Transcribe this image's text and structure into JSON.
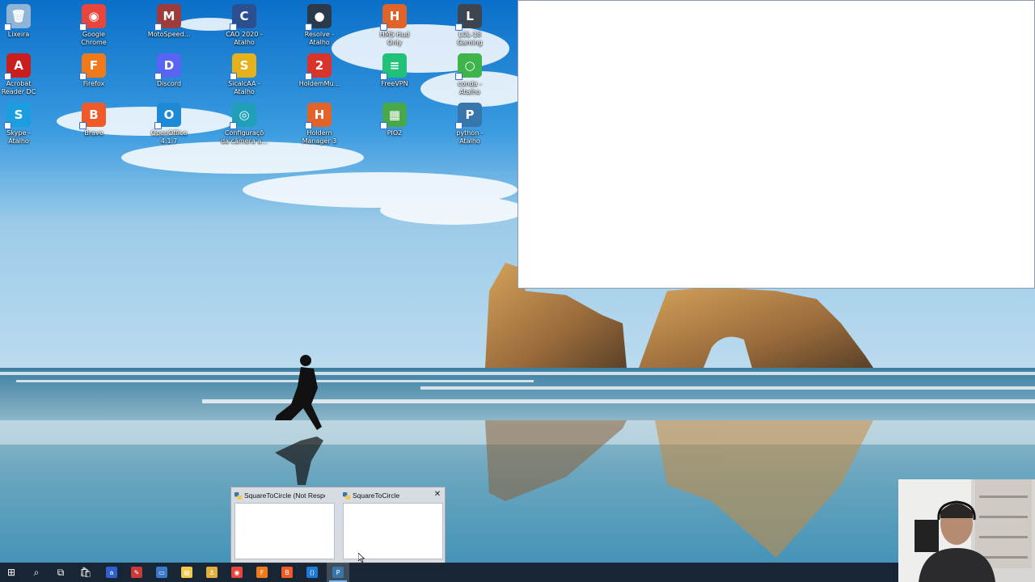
{
  "desktop": {
    "icons": [
      {
        "label": "Lixeira",
        "glyph": "🗑",
        "color": "#8fb4d8"
      },
      {
        "label": "Google\nChrome",
        "glyph": "◉",
        "color": "#e8453c"
      },
      {
        "label": "MotoSpeed...",
        "glyph": "M",
        "color": "#9e3b3b"
      },
      {
        "label": "CAO 2020 -\nAtalho",
        "glyph": "C",
        "color": "#2c4f8f"
      },
      {
        "label": "Resolve -\nAtalho",
        "glyph": "●",
        "color": "#2b3a4a"
      },
      {
        "label": "HMS Hud\nOnly",
        "glyph": "H",
        "color": "#e0632a"
      },
      {
        "label": "LOL-18\nGaming",
        "glyph": "L",
        "color": "#3d4550"
      },
      {
        "label": "Acrobat\nReader DC",
        "glyph": "A",
        "color": "#c81e1e"
      },
      {
        "label": "Firefox",
        "glyph": "F",
        "color": "#f07a1a"
      },
      {
        "label": "Discord",
        "glyph": "D",
        "color": "#5865f2"
      },
      {
        "label": "SicalcAA -\nAtalho",
        "glyph": "S",
        "color": "#e5b21c"
      },
      {
        "label": "HoldemMu...",
        "glyph": "2",
        "color": "#d9342b"
      },
      {
        "label": "FreeVPN",
        "glyph": "≡",
        "color": "#22c17a"
      },
      {
        "label": "conda -\nAtalho",
        "glyph": "○",
        "color": "#3db54a"
      },
      {
        "label": "Skype -\nAtalho",
        "glyph": "S",
        "color": "#1b9ee0"
      },
      {
        "label": "Brave",
        "glyph": "B",
        "color": "#f05a28"
      },
      {
        "label": "OpenOffice\n4.1.7",
        "glyph": "O",
        "color": "#1e8ad6"
      },
      {
        "label": "Configuraçõ\nda câmera a...",
        "glyph": "◎",
        "color": "#1fa0b8"
      },
      {
        "label": "Holdem\nManager 3",
        "glyph": "H",
        "color": "#e0632a"
      },
      {
        "label": "PIO2",
        "glyph": "▦",
        "color": "#49a84a"
      },
      {
        "label": "python -\nAtalho",
        "glyph": "P",
        "color": "#3776ab"
      }
    ]
  },
  "thumbnail_popup": {
    "items": [
      {
        "title": "SquareToCircle (Not Respondi..."
      },
      {
        "title": "SquareToCircle",
        "close_glyph": "✕"
      }
    ]
  },
  "taskbar": {
    "items": [
      {
        "name": "start-icon",
        "glyph": "⊞",
        "color": "#ffffff"
      },
      {
        "name": "search-icon",
        "glyph": "⌕",
        "color": "#ffffff"
      },
      {
        "name": "task-view-icon",
        "glyph": "⧉",
        "color": "#ffffff"
      },
      {
        "name": "store-icon",
        "glyph": "🛍",
        "color": "#ffffff"
      },
      {
        "name": "a-app-icon",
        "glyph": "a",
        "color": "#2d5fd1"
      },
      {
        "name": "photoshop-like-icon",
        "glyph": "✎",
        "color": "#c63a3a"
      },
      {
        "name": "window-app-icon",
        "glyph": "▭",
        "color": "#3a78c9"
      },
      {
        "name": "file-explorer-icon",
        "glyph": "▤",
        "color": "#f2c94c"
      },
      {
        "name": "anchor-icon",
        "glyph": "⚓",
        "color": "#e0b03a"
      },
      {
        "name": "chrome-icon",
        "glyph": "◉",
        "color": "#e8453c"
      },
      {
        "name": "firefox-icon",
        "glyph": "F",
        "color": "#f07a1a"
      },
      {
        "name": "brave-icon",
        "glyph": "B",
        "color": "#f05a28"
      },
      {
        "name": "vscode-icon",
        "glyph": "⟨⟩",
        "color": "#1f7ad6"
      },
      {
        "name": "python-icon",
        "glyph": "P",
        "color": "#3776ab",
        "active": true
      }
    ]
  }
}
